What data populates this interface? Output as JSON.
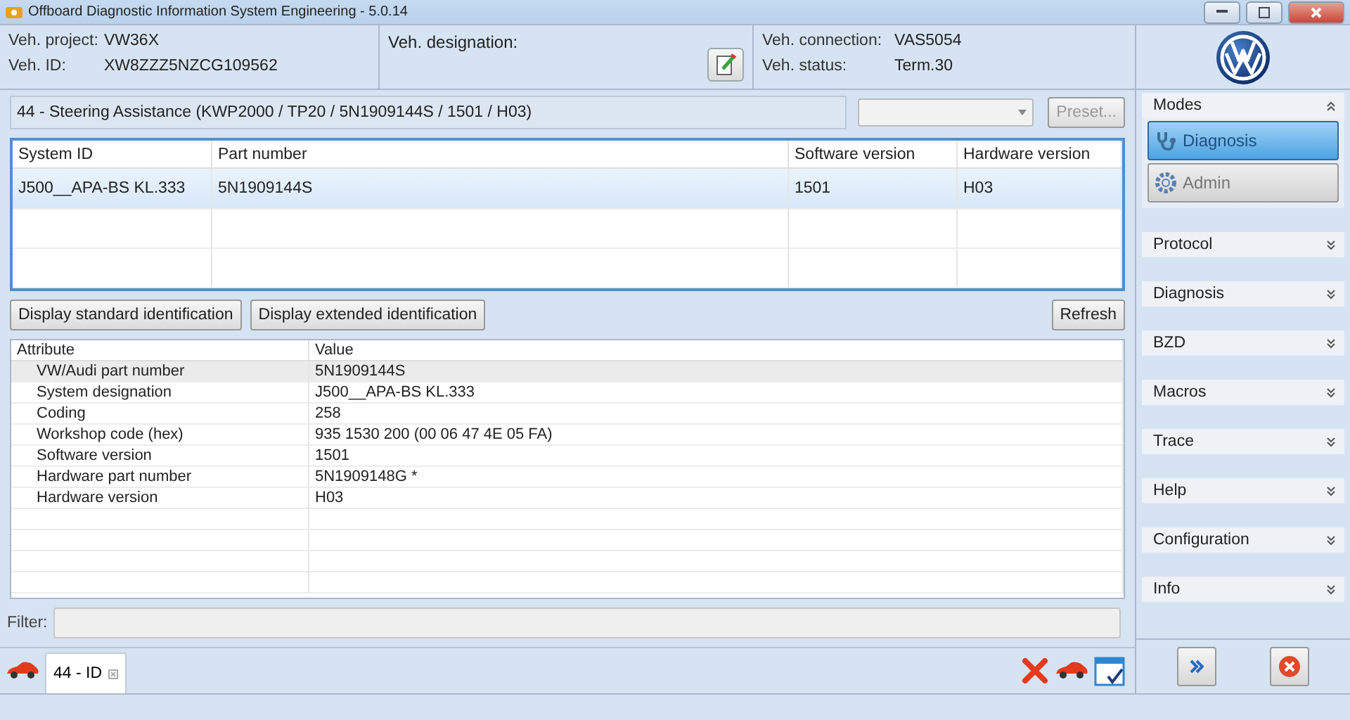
{
  "window": {
    "title": "Offboard Diagnostic Information System Engineering - 5.0.14"
  },
  "header": {
    "fields_left": [
      {
        "label": "Veh. project:",
        "value": "VW36X"
      },
      {
        "label": "Veh. ID:",
        "value": "XW8ZZZ5NZCG109562"
      }
    ],
    "designation_label": "Veh. designation:",
    "fields_right": [
      {
        "label": "Veh. connection:",
        "value": "VAS5054"
      },
      {
        "label": "Veh. status:",
        "value": "Term.30"
      }
    ]
  },
  "ecu": {
    "title": "44 - Steering Assistance  (KWP2000 / TP20 / 5N1909144S   / 1501 / H03)",
    "preset_button": {
      "label": "Preset...",
      "disabled": true
    }
  },
  "system_table": {
    "columns": [
      "System ID",
      "Part number",
      "Software version",
      "Hardware version"
    ],
    "rows": [
      {
        "cells": [
          "J500__APA-BS KL.333",
          "5N1909144S",
          "1501",
          "H03"
        ],
        "selected": true
      }
    ]
  },
  "identification_buttons": [
    "Display standard identification",
    "Display extended identification"
  ],
  "refresh_button": "Refresh",
  "attribute_table": {
    "columns": [
      "Attribute",
      "Value"
    ],
    "rows": [
      {
        "attribute": "VW/Audi part number",
        "value": "5N1909144S",
        "selected": true
      },
      {
        "attribute": "System designation",
        "value": "J500__APA-BS KL.333",
        "selected": false
      },
      {
        "attribute": "Coding",
        "value": "258",
        "selected": false
      },
      {
        "attribute": "Workshop code (hex)",
        "value": "935 1530 200 (00 06 47 4E 05 FA)",
        "selected": false
      },
      {
        "attribute": "Software version",
        "value": "1501",
        "selected": false
      },
      {
        "attribute": "Hardware part number",
        "value": "5N1909148G  *",
        "selected": false
      },
      {
        "attribute": "Hardware version",
        "value": "H03",
        "selected": false
      }
    ]
  },
  "filter": {
    "label": "Filter:"
  },
  "tabs": [
    {
      "label": "44 - ID",
      "selected": true
    }
  ],
  "sidebar": {
    "sections": [
      {
        "title": "Modes",
        "expanded": true,
        "buttons": [
          {
            "label": "Diagnosis",
            "selected": true
          },
          {
            "label": "Admin",
            "selected": false
          }
        ]
      },
      {
        "title": "Protocol",
        "expanded": false
      },
      {
        "title": "Diagnosis",
        "expanded": false
      },
      {
        "title": "BZD",
        "expanded": false
      },
      {
        "title": "Macros",
        "expanded": false
      },
      {
        "title": "Trace",
        "expanded": false
      },
      {
        "title": "Help",
        "expanded": false
      },
      {
        "title": "Configuration",
        "expanded": false
      },
      {
        "title": "Info",
        "expanded": false
      }
    ]
  }
}
